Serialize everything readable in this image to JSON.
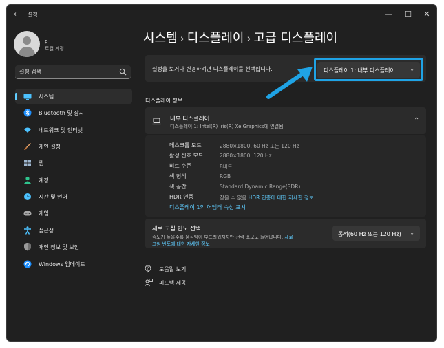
{
  "window": {
    "title": "설정",
    "controls": {
      "minimize": "—",
      "maximize": "☐",
      "close": "✕"
    },
    "back_glyph": "←"
  },
  "user": {
    "name": "p",
    "account": "로컬 계정"
  },
  "search": {
    "placeholder": "설정 검색"
  },
  "sidebar": {
    "items": [
      {
        "label": "시스템",
        "icon": "display-icon",
        "active": true
      },
      {
        "label": "Bluetooth 및 장치",
        "icon": "bluetooth-icon"
      },
      {
        "label": "네트워크 및 인터넷",
        "icon": "wifi-icon"
      },
      {
        "label": "개인 설정",
        "icon": "brush-icon"
      },
      {
        "label": "앱",
        "icon": "apps-icon"
      },
      {
        "label": "계정",
        "icon": "account-icon"
      },
      {
        "label": "시간 및 언어",
        "icon": "globe-clock-icon"
      },
      {
        "label": "게임",
        "icon": "gamepad-icon"
      },
      {
        "label": "접근성",
        "icon": "accessibility-icon"
      },
      {
        "label": "개인 정보 및 보안",
        "icon": "shield-icon"
      },
      {
        "label": "Windows 업데이트",
        "icon": "update-icon"
      }
    ]
  },
  "breadcrumb": {
    "level1": "시스템",
    "level2": "디스플레이",
    "current": "고급 디스플레이",
    "sep": "›"
  },
  "select_display": {
    "prompt": "설정을 보거나 변경하려면 디스플레이를 선택합니다.",
    "selected": "디스플레이 1: 내부 디스플레이",
    "chevron": "⌄"
  },
  "display_info": {
    "section_title": "디스플레이 정보",
    "name": "내부 디스플레이",
    "subtitle": "디스플레이 1: Intel(R) Iris(R) Xe Graphics에 연결됨",
    "collapse_glyph": "⌃",
    "props": [
      {
        "label": "데스크톱 모드",
        "value": "2880×1800, 60 Hz 또는 120 Hz"
      },
      {
        "label": "활성 신호 모드",
        "value": "2880×1800, 120 Hz"
      },
      {
        "label": "비트 수준",
        "value": "8비트"
      },
      {
        "label": "색 형식",
        "value": "RGB"
      },
      {
        "label": "색 공간",
        "value": "Standard Dynamic Range(SDR)"
      }
    ],
    "hdr": {
      "label": "HDR 인증",
      "value_prefix": "찾을 수 없음",
      "link": "HDR 인증에 대한 자세한 정보"
    },
    "adapter_link": "디스플레이 1의 어댑터 속성 표시"
  },
  "refresh": {
    "title": "새로 고침 빈도 선택",
    "desc_line1_prefix": "속도가 높을수록 움직임이 부드러워지지만 전력 소모도 늘어납니다.",
    "desc_line1_link": "새로",
    "desc_line2_link": "고침 빈도에 대한 자세한 정보",
    "selected": "동적(60 Hz 또는 120 Hz)",
    "chevron": "⌄"
  },
  "footer": {
    "help": "도움말 보기",
    "feedback": "피드백 제공"
  },
  "colors": {
    "accent": "#60cdff",
    "annotation": "#1fa3e5",
    "background": "#202020",
    "card": "#2b2b2b"
  }
}
